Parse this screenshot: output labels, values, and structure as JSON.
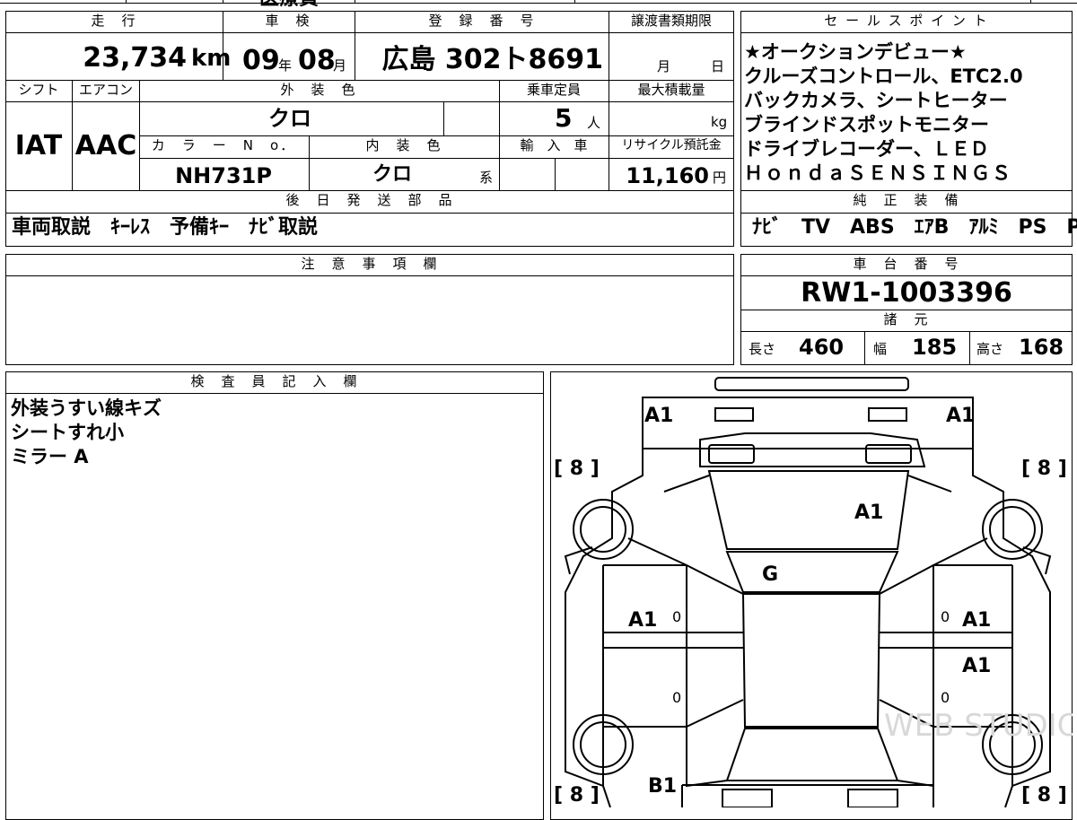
{
  "top_strip": {
    "partial": "医療費"
  },
  "headers": {
    "mileage": "走　行",
    "inspection": "車　検",
    "registration": "登　録　番　号",
    "transfer_deadline": "譲渡書類期限",
    "shift": "シフト",
    "aircon": "エアコン",
    "exterior_color": "外　装　色",
    "capacity": "乗車定員",
    "max_load": "最大積載量",
    "color_no": "カ　ラ　ー　N　o．",
    "interior_color": "内　装　色",
    "import": "輸　入　車",
    "recycle": "リサイクル預託金",
    "later_parts": "後　日　発　送　部　品",
    "sales_points": "セ ー ル ス ポ イ ン ト",
    "genuine_equipment": "純　正　装　備",
    "notes": "注　意　事　項　欄",
    "chassis_no": "車　台　番　号",
    "specs": "諸　元",
    "inspector": "検　査　員　記　入　欄"
  },
  "values": {
    "mileage": "23,734",
    "mileage_unit": "km",
    "inspection_year": "09",
    "year_unit": "年",
    "inspection_month": "08",
    "month_unit": "月",
    "registration": "広島 302ト8691",
    "deadline_month_unit": "月",
    "deadline_day_unit": "日",
    "shift": "IAT",
    "aircon": "AAC",
    "exterior_color": "クロ",
    "capacity": "5",
    "capacity_unit": "人",
    "load_unit": "kg",
    "color_no": "NH731P",
    "interior_color": "クロ",
    "interior_suffix": "系",
    "recycle": "11,160",
    "recycle_unit": "円",
    "later_parts": "車両取説　ｷｰﾚｽ　予備ｷｰ　ﾅﾋﾞ取説",
    "genuine_equipment": "ﾅﾋﾞ　TV　ABS　ｴｱB　ｱﾙﾐ　PS　PW",
    "chassis_no": "RW1-1003396",
    "length_label": "長さ",
    "length": "460",
    "width_label": "幅",
    "width": "185",
    "height_label": "高さ",
    "height": "168"
  },
  "sales_points": [
    "★オークションデビュー★",
    "クルーズコントロール、ETC2.0",
    "バックカメラ、シートヒーター",
    "ブラインドスポットモニター",
    "ドライブレコーダー、ＬＥＤ",
    "ＨｏｎｄａＳＥＮＳＩＮＧＳ"
  ],
  "inspector_notes": [
    "外装うすい線キズ",
    "シートすれ小",
    "ミラー A"
  ],
  "diagram": {
    "marks": {
      "front_left": "A1",
      "front_right": "A1",
      "hood": "A1",
      "windshield": "G",
      "left_front_door": "A1",
      "right_front_door": "A1",
      "right_rear_door": "A1",
      "rear_left": "B1",
      "tire_fl": "8",
      "tire_fr": "8",
      "tire_rl": "8",
      "tire_rr": "8",
      "zero": "0"
    },
    "watermark": "WEB STUDIO PRO"
  }
}
